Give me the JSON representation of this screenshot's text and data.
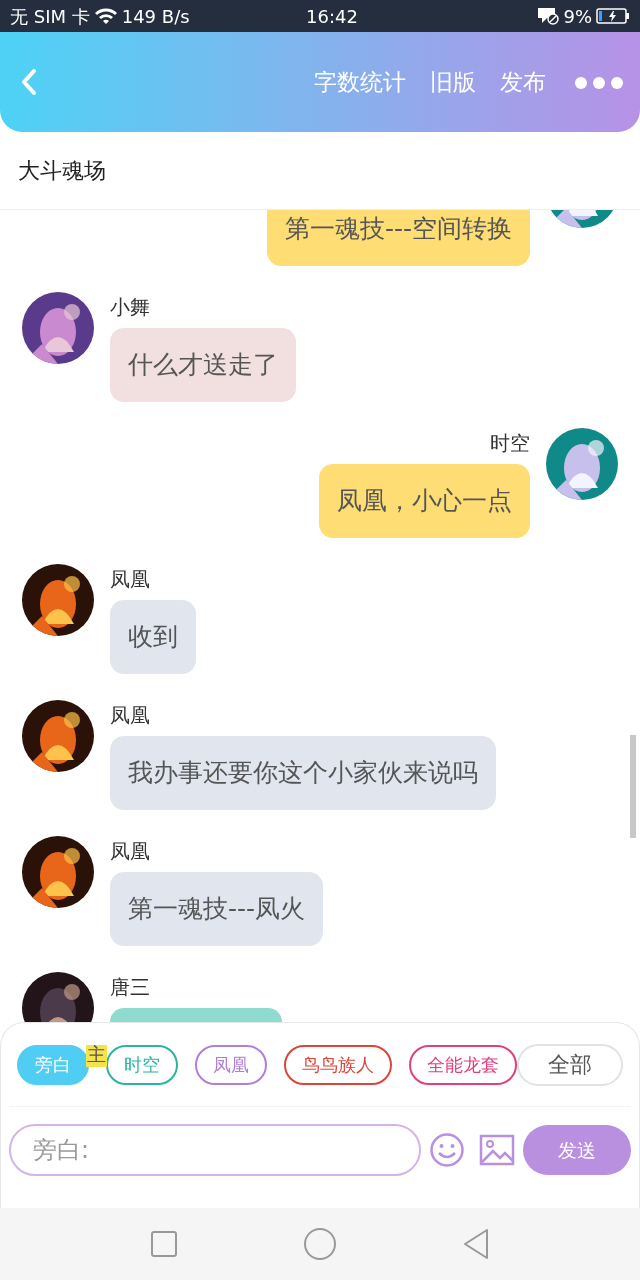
{
  "status_bar": {
    "carrier": "无 SIM 卡",
    "speed": "149 B/s",
    "time": "16:42",
    "battery": "9%"
  },
  "header": {
    "actions": [
      "字数统计",
      "旧版",
      "发布"
    ]
  },
  "title": "大斗魂场",
  "messages": [
    {
      "outgoing": true,
      "text": "第一魂技---空间转换",
      "color": "#fddd74"
    },
    {
      "outgoing": false,
      "name": "小舞",
      "text": "什么才送走了",
      "color": "#f2dfe0"
    },
    {
      "outgoing": true,
      "name": "时空",
      "text": "凤凰，小心一点",
      "color": "#fddd74"
    },
    {
      "outgoing": false,
      "name": "凤凰",
      "text": "收到",
      "color": "#e1e6ee"
    },
    {
      "outgoing": false,
      "name": "凤凰",
      "text": "我办事还要你这个小家伙来说吗",
      "color": "#e1e6ee"
    },
    {
      "outgoing": false,
      "name": "凤凰",
      "text": "第一魂技---凤火",
      "color": "#e1e6ee"
    },
    {
      "outgoing": false,
      "name": "唐三",
      "color": "#8fdbcf"
    }
  ],
  "roles": [
    {
      "label": "旁白",
      "selected": true,
      "color": "#4fcdf2"
    },
    {
      "label": "时空",
      "selected": false,
      "color": "#2bb5a0",
      "main_tag": "主"
    },
    {
      "label": "凤凰",
      "selected": false,
      "color": "#b07fd6"
    },
    {
      "label": "鸟鸟族人",
      "selected": false,
      "color": "#d9463c"
    },
    {
      "label": "全能龙套",
      "selected": false,
      "color": "#e0407e"
    }
  ],
  "all_button": "全部",
  "input": {
    "placeholder": "旁白:"
  },
  "send_button": "发送"
}
